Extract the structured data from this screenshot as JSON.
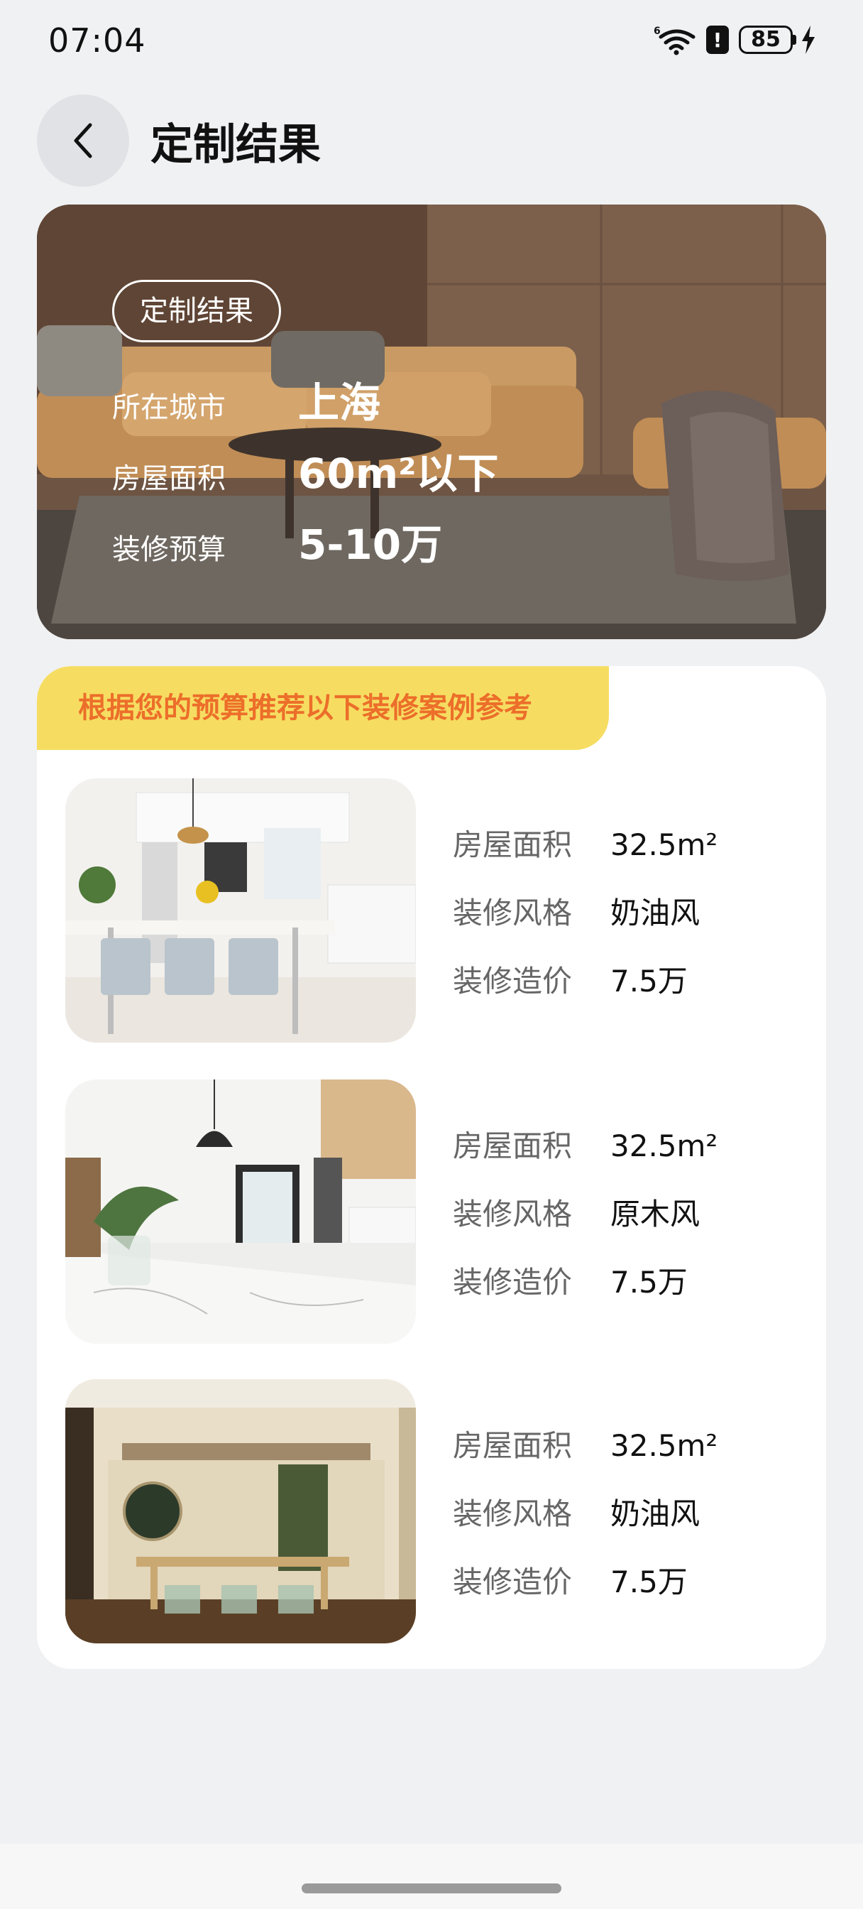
{
  "status": {
    "time": "07:04",
    "battery": "85",
    "icons": [
      "wifi-icon",
      "alert-icon",
      "battery-icon",
      "charging-bolt-icon"
    ]
  },
  "header": {
    "back_icon": "chevron-left-icon",
    "title": "定制结果"
  },
  "hero": {
    "tag": "定制结果",
    "rows": [
      {
        "label": "所在城市",
        "value": "上海"
      },
      {
        "label": "房屋面积",
        "value": "60m²以下"
      },
      {
        "label": "装修预算",
        "value": "5-10万"
      }
    ]
  },
  "results": {
    "banner": "根据您的预算推荐以下装修案例参考",
    "cases": [
      {
        "area_label": "房屋面积",
        "area": "32.5m²",
        "style_label": "装修风格",
        "style": "奶油风",
        "cost_label": "装修造价",
        "cost": "7.5万"
      },
      {
        "area_label": "房屋面积",
        "area": "32.5m²",
        "style_label": "装修风格",
        "style": "原木风",
        "cost_label": "装修造价",
        "cost": "7.5万"
      },
      {
        "area_label": "房屋面积",
        "area": "32.5m²",
        "style_label": "装修风格",
        "style": "奶油风",
        "cost_label": "装修造价",
        "cost": "7.5万"
      }
    ]
  },
  "colors": {
    "accent_orange": "#ec6e2a",
    "banner_yellow": "#f6dd62",
    "background": "#f0f1f3"
  }
}
